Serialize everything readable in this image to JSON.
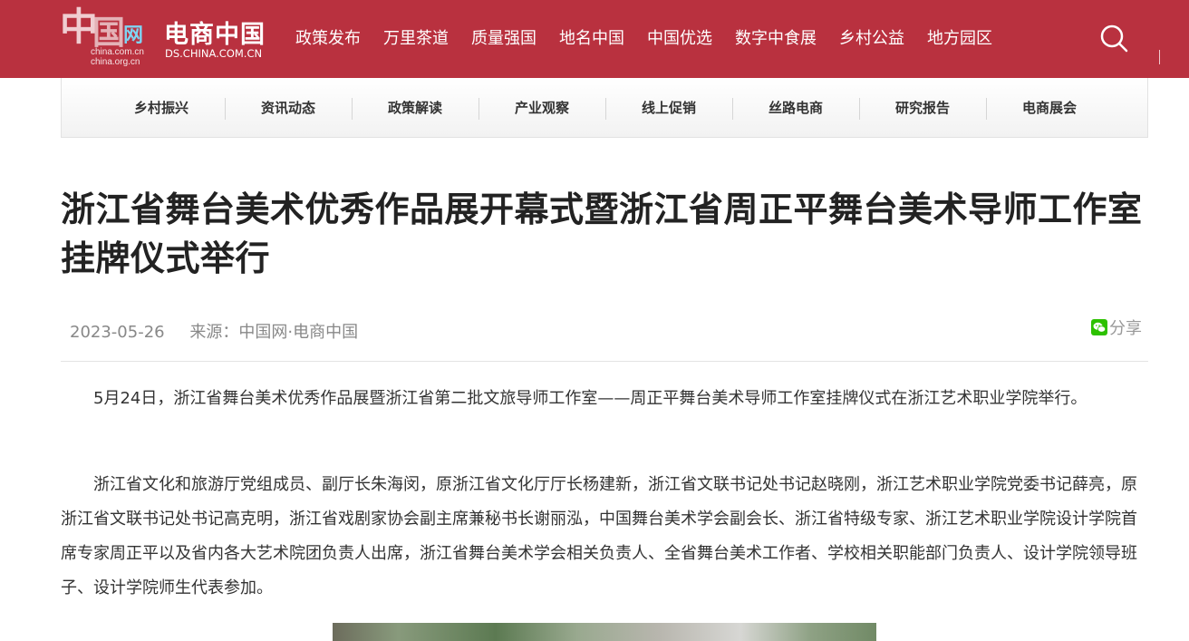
{
  "header": {
    "logo_text": "中国网",
    "logo_sub": "china.com.cn / china.org.cn",
    "site_name": "电商中国",
    "site_url": "DS.CHINA.COM.CN",
    "nav": [
      "政策发布",
      "万里茶道",
      "质量强国",
      "地名中国",
      "中国优选",
      "数字中食展",
      "乡村公益",
      "地方园区"
    ],
    "search_icon": "search-icon",
    "brand_color": "#b9313f"
  },
  "subnav": [
    "乡村振兴",
    "资讯动态",
    "政策解读",
    "产业观察",
    "线上促销",
    "丝路电商",
    "研究报告",
    "电商展会"
  ],
  "article": {
    "title": "浙江省舞台美术优秀作品展开幕式暨浙江省周正平舞台美术导师工作室挂牌仪式举行",
    "date": "2023-05-26",
    "source": "来源：中国网·电商中国",
    "share": "分享",
    "paragraphs": [
      "5月24日，浙江省舞台美术优秀作品展暨浙江省第二批文旅导师工作室——周正平舞台美术导师工作室挂牌仪式在浙江艺术职业学院举行。",
      "浙江省文化和旅游厅党组成员、副厅长朱海闵，原浙江省文化厅厅长杨建新，浙江省文联书记处书记赵晓刚，浙江艺术职业学院党委书记薛亮，原浙江省文联书记处书记高克明，浙江省戏剧家协会副主席兼秘书长谢丽泓，中国舞台美术学会副会长、浙江省特级专家、浙江艺术职业学院设计学院首席专家周正平以及省内各大艺术院团负责人出席，浙江省舞台美术学会相关负责人、全省舞台美术工作者、学校相关职能部门负责人、设计学院领导班子、设计学院师生代表参加。"
    ]
  }
}
